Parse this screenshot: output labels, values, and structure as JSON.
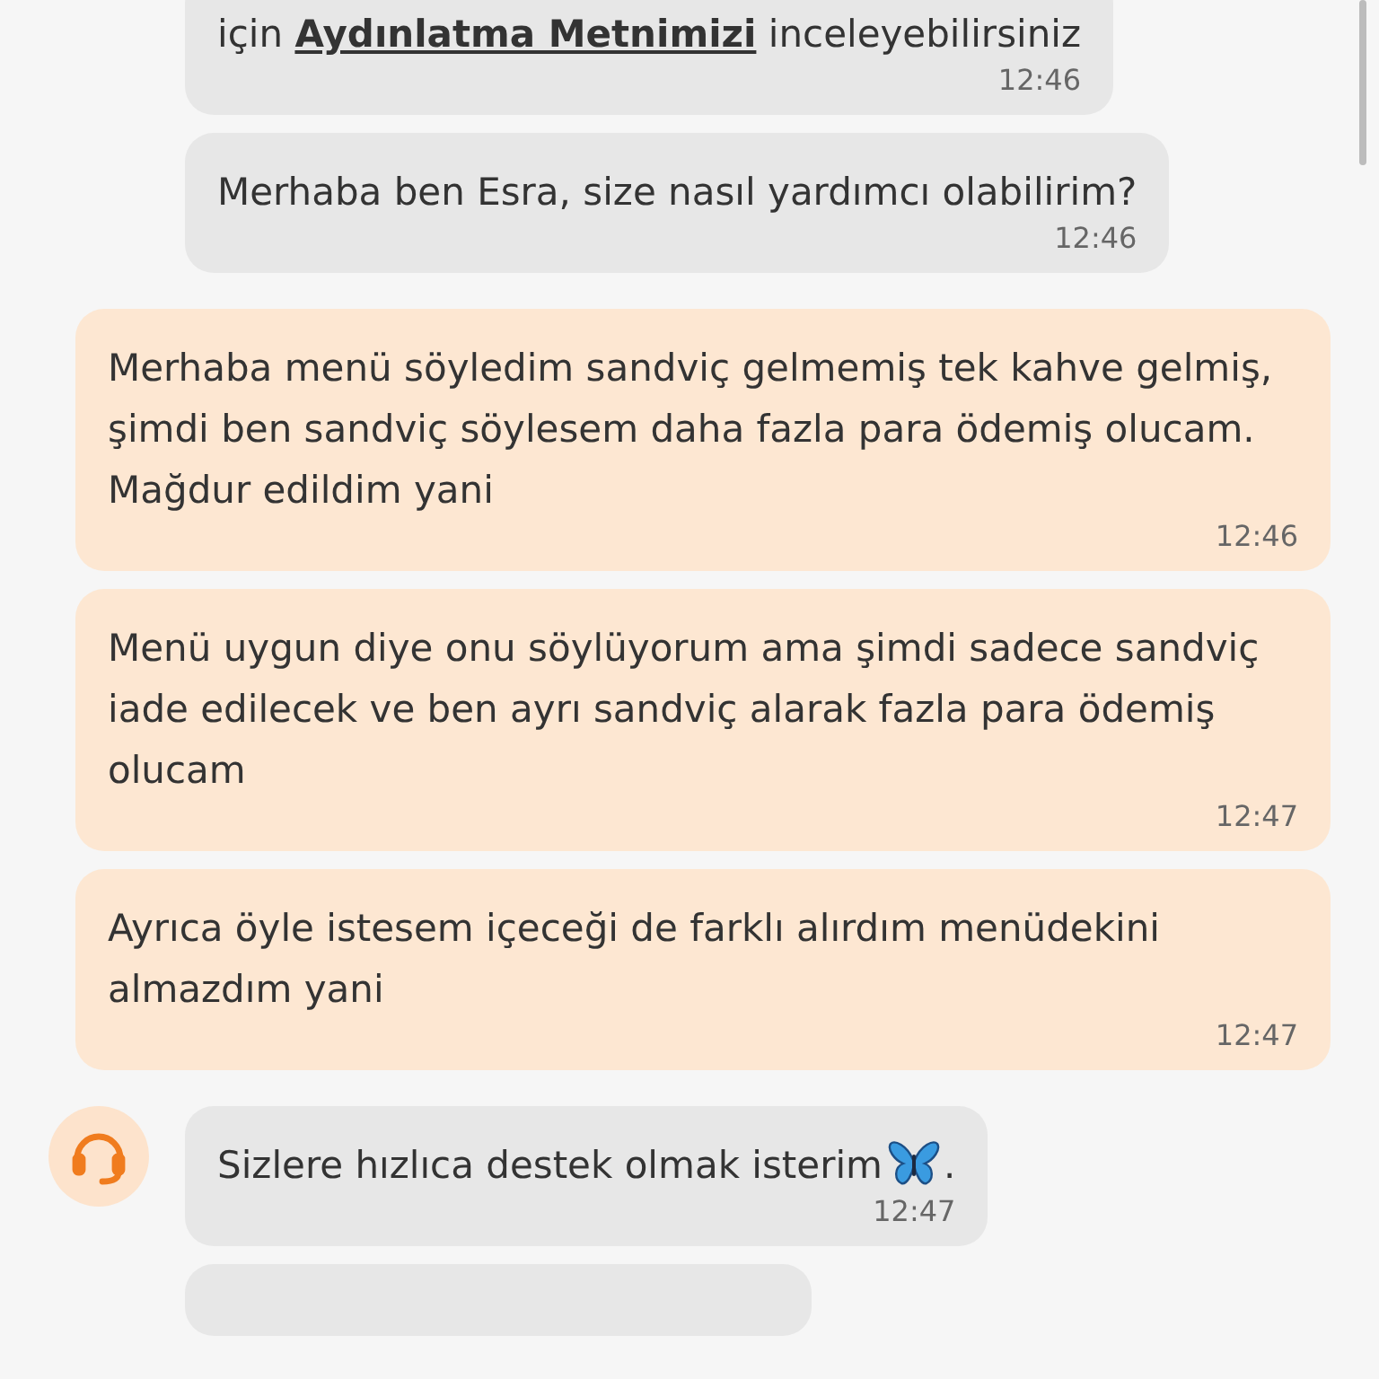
{
  "messages": [
    {
      "kind": "agent",
      "parts": [
        {
          "kind": "plain",
          "text": "için"
        },
        {
          "kind": "link",
          "text": "Aydınlatma Metnimizi"
        },
        {
          "kind": "plain",
          "text": "inceleyebilirsiniz"
        }
      ],
      "time": "12:46",
      "avatar": false
    },
    {
      "kind": "agent",
      "parts": [
        {
          "kind": "plain",
          "text": "Merhaba ben Esra, size nasıl yardımcı olabilirim?"
        }
      ],
      "time": "12:46",
      "avatar": false
    },
    {
      "kind": "user",
      "parts": [
        {
          "kind": "plain",
          "text": "Merhaba menü söyledim sandviç gelmemiş tek kahve gelmiş, şimdi ben sandviç söylesem daha fazla para ödemiş olucam. Mağdur edildim yani"
        }
      ],
      "time": "12:46"
    },
    {
      "kind": "user",
      "parts": [
        {
          "kind": "plain",
          "text": "Menü uygun diye onu söylüyorum ama şimdi sadece sandviç iade edilecek ve ben ayrı sandviç alarak fazla para ödemiş olucam"
        }
      ],
      "time": "12:47"
    },
    {
      "kind": "user",
      "parts": [
        {
          "kind": "plain",
          "text": "Ayrıca öyle istesem içeceği de farklı alırdım menüdekini almazdım yani"
        }
      ],
      "time": "12:47"
    },
    {
      "kind": "agent",
      "parts": [
        {
          "kind": "plain",
          "text": "Sizlere hızlıca destek olmak isterim"
        },
        {
          "kind": "emoji"
        },
        {
          "kind": "plain",
          "text": "."
        }
      ],
      "time": "12:47",
      "avatar": true
    }
  ]
}
